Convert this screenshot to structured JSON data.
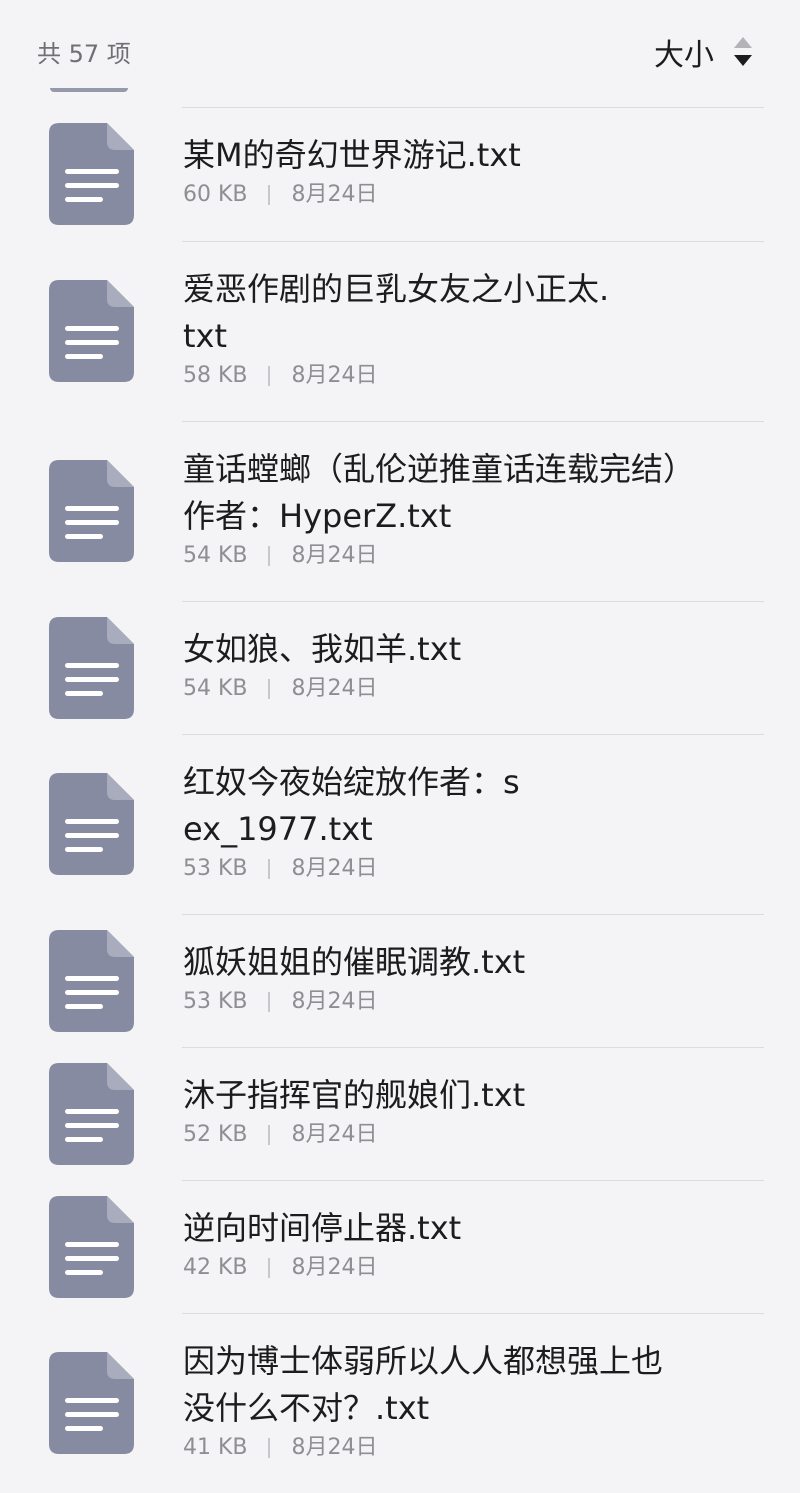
{
  "header": {
    "count_label": "共 57 项",
    "sort_label": "大小"
  },
  "colors": {
    "icon_fill": "#878ba1",
    "background": "#f4f4f6",
    "meta_text": "#8e8e93"
  },
  "files": [
    {
      "name": "某M的奇幻世界游记.txt",
      "size": "60 KB",
      "date": "8月24日",
      "icon": "document-icon"
    },
    {
      "name": "爱恶作剧的巨乳女友之小正太.txt",
      "size": "58 KB",
      "date": "8月24日",
      "icon": "document-icon"
    },
    {
      "name": "童话螳螂（乱伦逆推童话连载完结）作者：HyperZ.txt",
      "size": "54 KB",
      "date": "8月24日",
      "icon": "document-icon"
    },
    {
      "name": "女如狼、我如羊.txt",
      "size": "54 KB",
      "date": "8月24日",
      "icon": "document-icon"
    },
    {
      "name": "红奴今夜始绽放作者：sex_1977.txt",
      "size": "53 KB",
      "date": "8月24日",
      "icon": "document-icon"
    },
    {
      "name": "狐妖姐姐的催眠调教.txt",
      "size": "53 KB",
      "date": "8月24日",
      "icon": "document-icon"
    },
    {
      "name": "沐子指挥官的舰娘们.txt",
      "size": "52 KB",
      "date": "8月24日",
      "icon": "document-icon"
    },
    {
      "name": "逆向时间停止器.txt",
      "size": "42 KB",
      "date": "8月24日",
      "icon": "document-icon"
    },
    {
      "name": "因为博士体弱所以人人都想强上也没什么不对？.txt",
      "size": "41 KB",
      "date": "8月24日",
      "icon": "document-icon"
    }
  ]
}
